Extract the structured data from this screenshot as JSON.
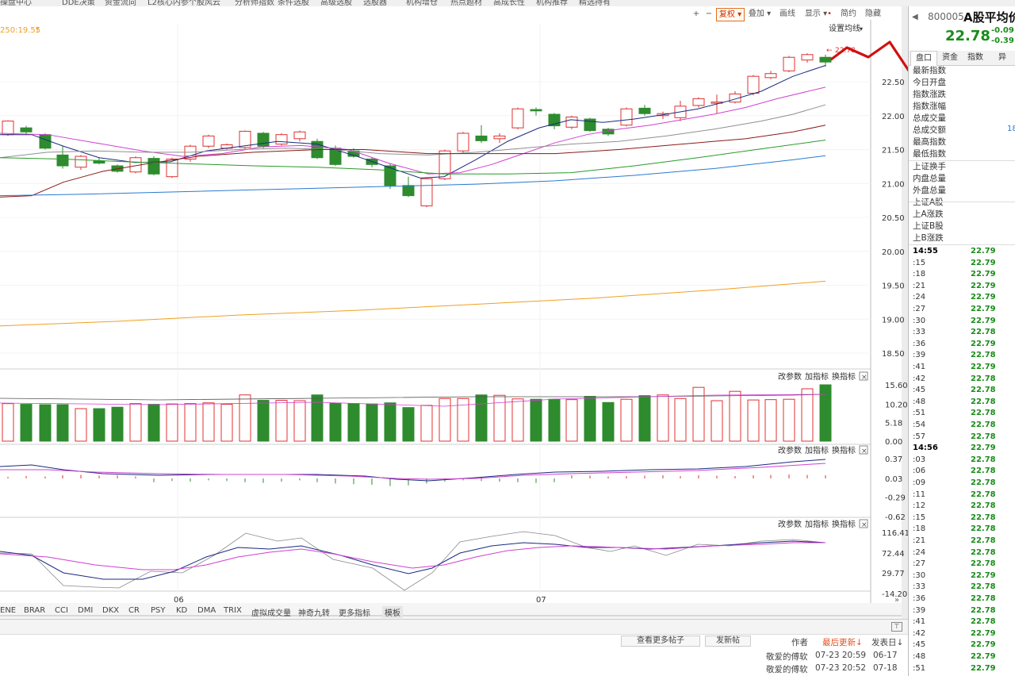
{
  "top_menu": [
    "操盘中心",
    "DDE决策",
    "资金流向",
    "L2核心内参",
    "个股风云",
    "分析师指数",
    "条件选股",
    "高级选股",
    "选股器",
    "机构增仓",
    "热点题材",
    "高成长性",
    "机构推荐",
    "精选持有"
  ],
  "toolbar": {
    "zoom_in": "+",
    "zoom_out": "−",
    "fuquan": "复权",
    "overlay": "叠加",
    "draw": "画线",
    "display": "显示",
    "simple": "简约",
    "hide": "隐藏"
  },
  "main": {
    "ma_legend": "250:19.55",
    "settings": "设置均线",
    "last_price_marker": "22.78",
    "y_ticks": [
      "22.50",
      "22.00",
      "21.50",
      "21.00",
      "20.50",
      "20.00",
      "19.50",
      "19.00",
      "18.50"
    ],
    "colors": {
      "up": "#e03030",
      "down": "#2e8b2e",
      "ma5": "#1a2a80",
      "ma10": "#d040d0",
      "ma20": "#909090",
      "ma30": "#8b1a1a",
      "ma60": "#2a9a2a",
      "ma120": "#2a7ad0",
      "ma250": "#f0a020",
      "annotation": "#d01010"
    }
  },
  "panels": {
    "param_label": "改参数",
    "add_label": "加指标",
    "swap_label": "换指标",
    "close": "×",
    "vol_ticks": [
      "15.60",
      "10.20",
      "5.18",
      "0.00"
    ],
    "macd_ticks": [
      "0.37",
      "0.03",
      "-0.29",
      "-0.62"
    ],
    "kdj_ticks": [
      "116.41",
      "72.44",
      "29.77",
      "-14.20"
    ]
  },
  "x_axis": {
    "month1": "06",
    "month2": "07"
  },
  "indicator_tabs": [
    "ENE",
    "BRAR",
    "CCI",
    "DMI",
    "DKX",
    "CR",
    "PSY",
    "KD",
    "DMA",
    "TRIX",
    "虚拟成交量",
    "神奇九转",
    "更多指标",
    "模板"
  ],
  "right_panel": {
    "code": "800005",
    "name": "A股平均价",
    "price": "22.78",
    "change": "-0.09",
    "change_pct": "-0.39",
    "tabs": [
      "盘口",
      "资金",
      "指数",
      "异"
    ],
    "labels": [
      "最新指数",
      "今日开盘",
      "指数涨跌",
      "指数涨幅",
      "总成交量",
      "总成交额",
      "最高指数",
      "最低指数",
      "上证换手",
      "内盘总量",
      "外盘总量",
      "上证A股",
      "上A涨跌",
      "上证B股",
      "上B涨跌"
    ],
    "volume_value": "18",
    "ticks": [
      {
        "t": "14:55",
        "p": "22.79",
        "bold": true
      },
      {
        "t": ":15",
        "p": "22.79"
      },
      {
        "t": ":18",
        "p": "22.79"
      },
      {
        "t": ":21",
        "p": "22.79"
      },
      {
        "t": ":24",
        "p": "22.79"
      },
      {
        "t": ":27",
        "p": "22.79"
      },
      {
        "t": ":30",
        "p": "22.79"
      },
      {
        "t": ":33",
        "p": "22.78"
      },
      {
        "t": ":36",
        "p": "22.79"
      },
      {
        "t": ":39",
        "p": "22.78"
      },
      {
        "t": ":41",
        "p": "22.79"
      },
      {
        "t": ":42",
        "p": "22.78"
      },
      {
        "t": ":45",
        "p": "22.78"
      },
      {
        "t": ":48",
        "p": "22.78"
      },
      {
        "t": ":51",
        "p": "22.78"
      },
      {
        "t": ":54",
        "p": "22.78"
      },
      {
        "t": ":57",
        "p": "22.78"
      },
      {
        "t": "14:56",
        "p": "22.79",
        "bold": true
      },
      {
        "t": ":03",
        "p": "22.78"
      },
      {
        "t": ":06",
        "p": "22.78"
      },
      {
        "t": ":09",
        "p": "22.78"
      },
      {
        "t": ":11",
        "p": "22.78"
      },
      {
        "t": ":12",
        "p": "22.78"
      },
      {
        "t": ":15",
        "p": "22.78"
      },
      {
        "t": ":18",
        "p": "22.78"
      },
      {
        "t": ":21",
        "p": "22.78"
      },
      {
        "t": ":24",
        "p": "22.78"
      },
      {
        "t": ":27",
        "p": "22.78"
      },
      {
        "t": ":30",
        "p": "22.79"
      },
      {
        "t": ":33",
        "p": "22.78"
      },
      {
        "t": ":36",
        "p": "22.78"
      },
      {
        "t": ":39",
        "p": "22.78"
      },
      {
        "t": ":41",
        "p": "22.78"
      },
      {
        "t": ":42",
        "p": "22.79"
      },
      {
        "t": ":45",
        "p": "22.79"
      },
      {
        "t": ":48",
        "p": "22.79"
      },
      {
        "t": ":51",
        "p": "22.79"
      }
    ]
  },
  "bottom": {
    "more_posts": "查看更多帖子",
    "new_post": "发新帖",
    "col_author": "作者",
    "col_last_update": "最后更新↓",
    "col_post_date": "发表日↓",
    "rows": [
      {
        "author": "敬爱的傅软",
        "last": "07-23 20:59",
        "date": "06-17"
      },
      {
        "author": "敬爱的傅软",
        "last": "07-23 20:52",
        "date": "07-18"
      }
    ]
  }
}
